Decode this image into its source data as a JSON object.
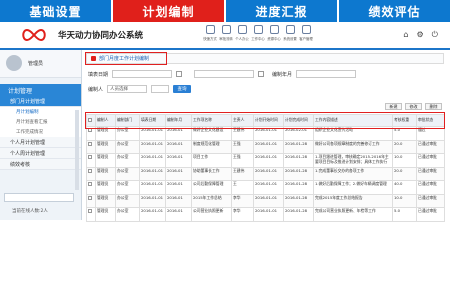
{
  "top_tabs": [
    {
      "label": "基础设置",
      "active": false
    },
    {
      "label": "计划编制",
      "active": true
    },
    {
      "label": "进度汇报",
      "active": false
    },
    {
      "label": "绩效评估",
      "active": false
    }
  ],
  "header": {
    "app_title": "华天动力协同办公系统",
    "toolbar_icons": [
      {
        "label": "快速方式",
        "icon": "shortcut-icon"
      },
      {
        "label": "审批流转",
        "icon": "approval-icon"
      },
      {
        "label": "个人办公",
        "icon": "person-icon"
      },
      {
        "label": "工作中心",
        "icon": "work-icon"
      },
      {
        "label": "资源中心",
        "icon": "resource-icon"
      },
      {
        "label": "系统设置",
        "icon": "settings-icon"
      },
      {
        "label": "客户管理",
        "icon": "customer-icon"
      }
    ],
    "right_icons": [
      "home-icon",
      "gear-icon",
      "power-icon"
    ]
  },
  "sidebar": {
    "username": "管理员",
    "main_nav": "计划管理",
    "groups": [
      {
        "label": "部门月计划管理",
        "active": true,
        "items": [
          {
            "label": "月计划编制",
            "active": true
          },
          {
            "label": "月计划查看汇报",
            "active": false
          },
          {
            "label": "工作完成情况",
            "active": false
          }
        ]
      },
      {
        "label": "个人月计划管理",
        "active": false,
        "items": []
      },
      {
        "label": "个人周计划管理",
        "active": false,
        "items": []
      },
      {
        "label": "绩效考核",
        "active": false,
        "items": []
      }
    ],
    "online_text": "当前在线人数:2人"
  },
  "breadcrumb": "部门月度工作计划编制",
  "filters": {
    "unit_label": "填表日期",
    "month_label": "编制年月",
    "dept_label": "编制人",
    "dept_value": "人员选择",
    "query_btn": "查询"
  },
  "actions": [
    "新建",
    "修改",
    "删除"
  ],
  "table": {
    "columns": [
      "",
      "编制人",
      "编制部门",
      "填表日期",
      "编制年月",
      "工作项名称",
      "主责人",
      "计划开始时间",
      "计划完成时间",
      "工作内容描述",
      "考核权重",
      "审批状态"
    ],
    "rows": [
      [
        "",
        "管理员",
        "办公室",
        "2016-01-01",
        "2016-01",
        "做好企业文化建设",
        "王建伟",
        "2016-01-01",
        "2016-02-01",
        "组织企业文化宣传活动",
        "5.0",
        "通过"
      ],
      [
        "",
        "管理员",
        "办公室",
        "2016-01-01",
        "2016-01",
        "制度规范化管理",
        "王强",
        "2016-01-01",
        "2016-01-28",
        "做好公司各项规章制度的完善修订工作",
        "20.0",
        "已通过审批"
      ],
      [
        "",
        "管理员",
        "办公室",
        "2016-01-01",
        "2016-01",
        "项目工作",
        "王强",
        "2016-01-01",
        "2016-01-28",
        "1.项目跟进管理，审核确定2015-2016年主要项目目标及推进计划安排；具体工作执行",
        "10.0",
        "已通过审批"
      ],
      [
        "",
        "管理员",
        "办公室",
        "2016-01-01",
        "2016-01",
        "协助董事长工作",
        "王建伟",
        "2016-01-01",
        "2016-01-28",
        "1.完成董事长交办的各项工作",
        "20.0",
        "已通过审批"
      ],
      [
        "",
        "管理员",
        "办公室",
        "2016-01-01",
        "2016-01",
        "公司后勤保障管理",
        "王",
        "2016-01-01",
        "2016-01-28",
        "1.做好后勤保障工作；2.做好车辆调度管理",
        "40.0",
        "已通过审批"
      ],
      [
        "",
        "管理员",
        "办公室",
        "2016-01-01",
        "2016-01",
        "2015年工作总结",
        "李华",
        "2016-01-01",
        "2016-01-28",
        "完成2015年度工作总结报告",
        "10.0",
        "已通过审批"
      ],
      [
        "",
        "管理员",
        "办公室",
        "2016-01-01",
        "2016-01",
        "公司营业执照更新",
        "李华",
        "2016-01-01",
        "2016-01-28",
        "完成公司营业执照更新、年检等工作",
        "5.0",
        "已通过审批"
      ]
    ]
  }
}
